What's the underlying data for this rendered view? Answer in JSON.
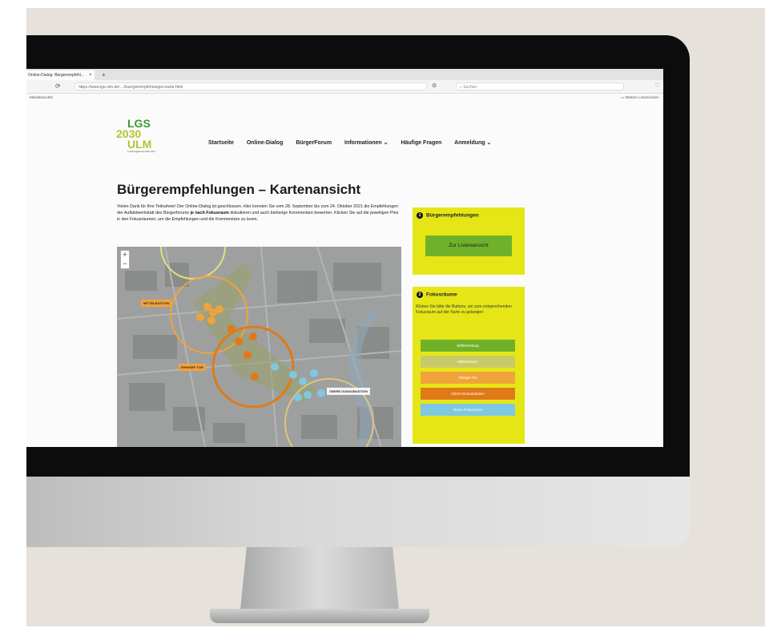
{
  "browser": {
    "tab_title": "Online-Dialog: Bürgerempfehl...",
    "tab_close": "×",
    "new_tab": "+",
    "url": "https://www.lgs-ulm.de/…/buergerempfehlungen-karte.html",
    "search_placeholder": "Suchen",
    "bookmarks_left": "Meistbesuchte",
    "bookmarks_right": "Weitere Lesezeichen"
  },
  "site": {
    "logo_line1": "LGS",
    "logo_line2": "2030",
    "logo_line3": "ULM",
    "logo_sub": "Landesgartenschau Ulm",
    "nav": [
      "Startseite",
      "Online-Dialog",
      "BürgerForum",
      "Informationen ⌄",
      "Häufige Fragen",
      "Anmeldung ⌄"
    ]
  },
  "main": {
    "title": "Bürgerempfehlungen – Kartenansicht",
    "intro_part1": "Vielen Dank für Ihre Teilnahme! Der Online-Dialog ist geschlossen. Hier konnten Sie vom 28. September bis zum 24. Oktober 2021 die Empfehlungen der Auftaktwerkstatt des Bürgerforums ",
    "intro_bold": "je nach Fokusraum",
    "intro_part2": " diskutieren und auch bisherige Kommentare bewerten. Klicken Sie auf die jeweiligen Pins in den Fokusräumen, um die Empfehlungen und die Kommentare zu lesen."
  },
  "map": {
    "zoom_in": "+",
    "zoom_out": "−",
    "labels": [
      "MITTELBASTION",
      "EHINGER TOR",
      "OBERE DONAUBASTION"
    ]
  },
  "sidebar": {
    "box1": {
      "num": "1",
      "title": "Bürgerempfehlungen",
      "button": "Zur Listenansicht"
    },
    "box2": {
      "num": "2",
      "title": "Fokusräume",
      "text": "Klicken Sie bitte die Buttons, um zum entsprechenden Fokusraum auf der Karte zu gelangen:",
      "buttons": [
        "Wilhelmsburg",
        "Mittelbastion",
        "Ehinger Tor",
        "Obere Donaubastion",
        "Neuer Fokusraum"
      ]
    }
  },
  "colors": {
    "accent_yellow": "#e6e617",
    "green": "#6fb22a",
    "orange": "#f1a33b",
    "dark_orange": "#e07a18",
    "light_blue": "#7ec8e3",
    "olive": "#b5c430"
  }
}
